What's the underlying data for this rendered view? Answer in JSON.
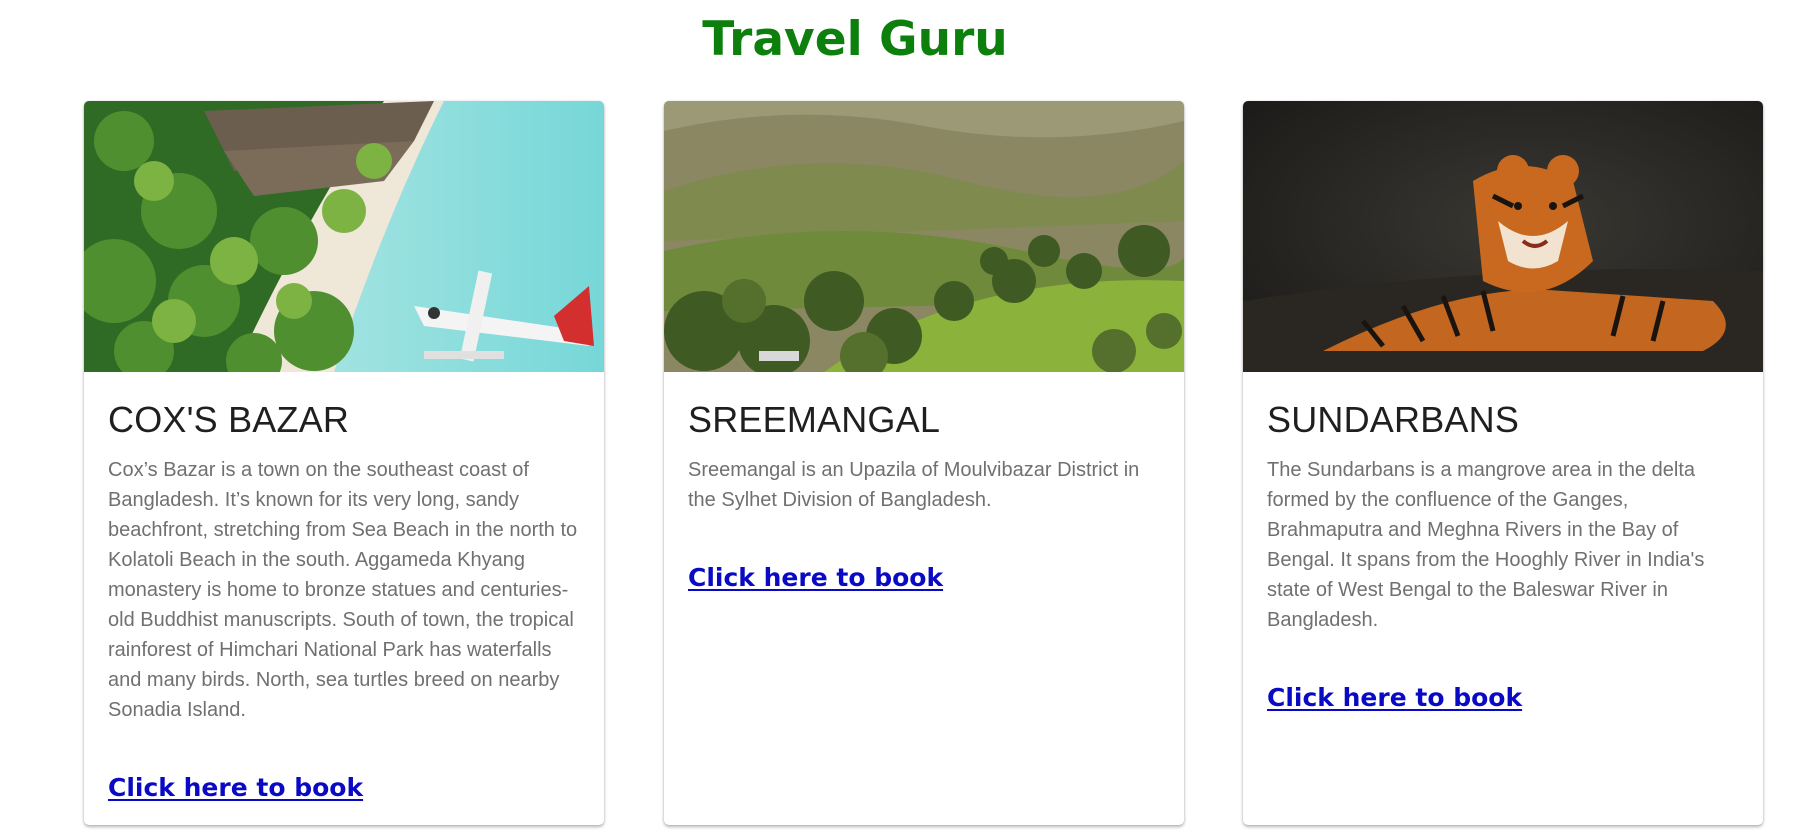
{
  "header": {
    "title": "Travel Guru",
    "title_color": "#0d7f0d"
  },
  "cards": [
    {
      "image": "beach-seaplane-photo",
      "title": "COX'S BAZAR",
      "description": "Cox’s Bazar is a town on the southeast coast of Bangladesh. It’s known for its very long, sandy beachfront, stretching from Sea Beach in the north to Kolatoli Beach in the south. Aggameda Khyang monastery is home to bronze statues and centuries-old Buddhist manuscripts. South of town, the tropical rainforest of Himchari National Park has waterfalls and many birds. North, sea turtles breed on nearby Sonadia Island.",
      "link_label": "Click here to book"
    },
    {
      "image": "green-hills-tea-garden-photo",
      "title": "SREEMANGAL",
      "description": "Sreemangal is an Upazila of Moulvibazar District in the Sylhet Division of Bangladesh.",
      "link_label": "Click here to book"
    },
    {
      "image": "tiger-photo",
      "title": "SUNDARBANS",
      "description": "The Sundarbans is a mangrove area in the delta formed by the confluence of the Ganges, Brahmaputra and Meghna Rivers in the Bay of Bengal. It spans from the Hooghly River in India's state of West Bengal to the Baleswar River in Bangladesh.",
      "link_label": "Click here to book"
    }
  ],
  "colors": {
    "link": "#0a0ac4",
    "description": "#707070",
    "card_title": "#1f1f1f"
  }
}
